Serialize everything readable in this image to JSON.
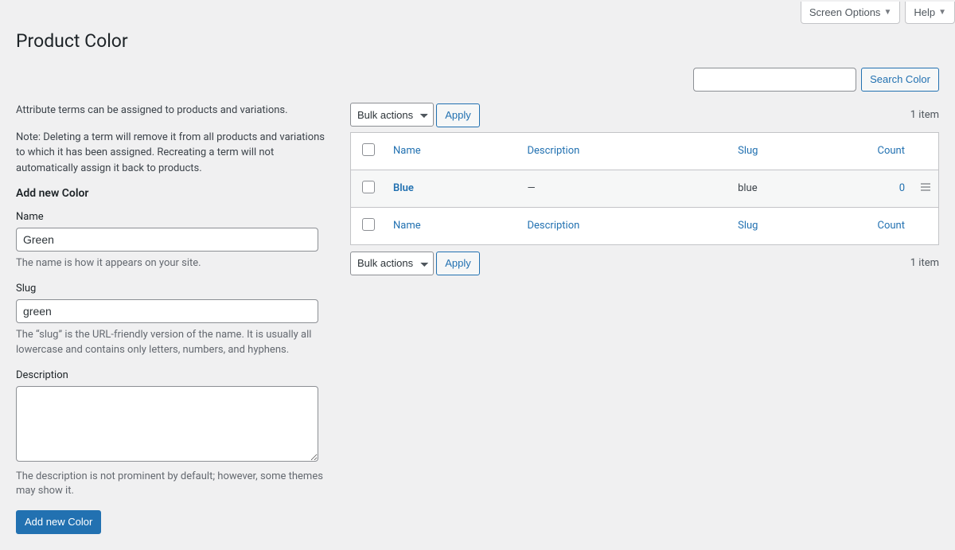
{
  "topButtons": {
    "screenOptions": "Screen Options",
    "help": "Help"
  },
  "pageTitle": "Product Color",
  "search": {
    "buttonLabel": "Search Color"
  },
  "intro": {
    "p1": "Attribute terms can be assigned to products and variations.",
    "p2": "Note: Deleting a term will remove it from all products and variations to which it has been assigned. Recreating a term will not automatically assign it back to products."
  },
  "form": {
    "heading": "Add new Color",
    "name": {
      "label": "Name",
      "value": "Green",
      "help": "The name is how it appears on your site."
    },
    "slug": {
      "label": "Slug",
      "value": "green",
      "help": "The “slug” is the URL-friendly version of the name. It is usually all lowercase and contains only letters, numbers, and hyphens."
    },
    "description": {
      "label": "Description",
      "value": "",
      "help": "The description is not prominent by default; however, some themes may show it."
    },
    "submit": "Add new Color"
  },
  "bulk": {
    "label": "Bulk actions",
    "apply": "Apply"
  },
  "itemCount": "1 item",
  "table": {
    "cols": {
      "name": "Name",
      "description": "Description",
      "slug": "Slug",
      "count": "Count"
    },
    "rows": [
      {
        "name": "Blue",
        "description": "—",
        "slug": "blue",
        "count": "0"
      }
    ]
  }
}
